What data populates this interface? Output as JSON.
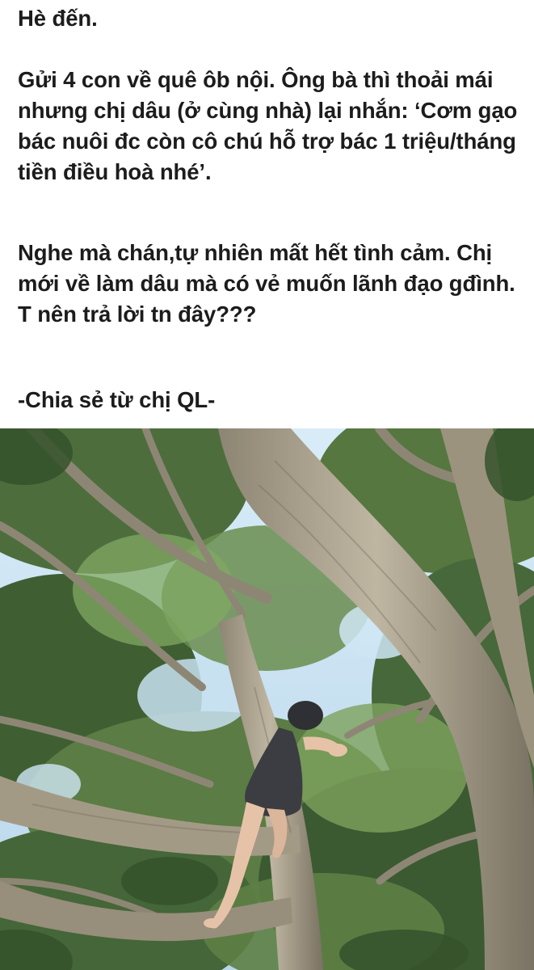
{
  "post": {
    "title": "Hè đến.",
    "paragraph_1": "Gửi 4 con về quê ôb nội. Ông bà thì thoải mái nhưng chị dâu (ở cùng nhà) lại nhắn: ‘Cơm gạo bác nuôi đc còn cô chú hỗ trợ bác 1 triệu/tháng tiền điều hoà nhé’.",
    "paragraph_2": "Nghe mà chán,tự nhiên mất hết tình cảm. Chị mới về làm dâu mà có vẻ muốn lãnh đạo gđình. T nên trả lời tn đây???",
    "credit": "-Chia sẻ từ chị QL-"
  },
  "photo": {
    "subject": "child-climbing-tree",
    "colors": {
      "sky": "#cfe6f5",
      "foliage_dark": "#3f5f33",
      "foliage_light": "#8fb36a",
      "bark": "#a9a08c",
      "bark_shadow": "#6f6758",
      "shirt": "#3b3d42",
      "skin": "#e6c3a8"
    }
  }
}
